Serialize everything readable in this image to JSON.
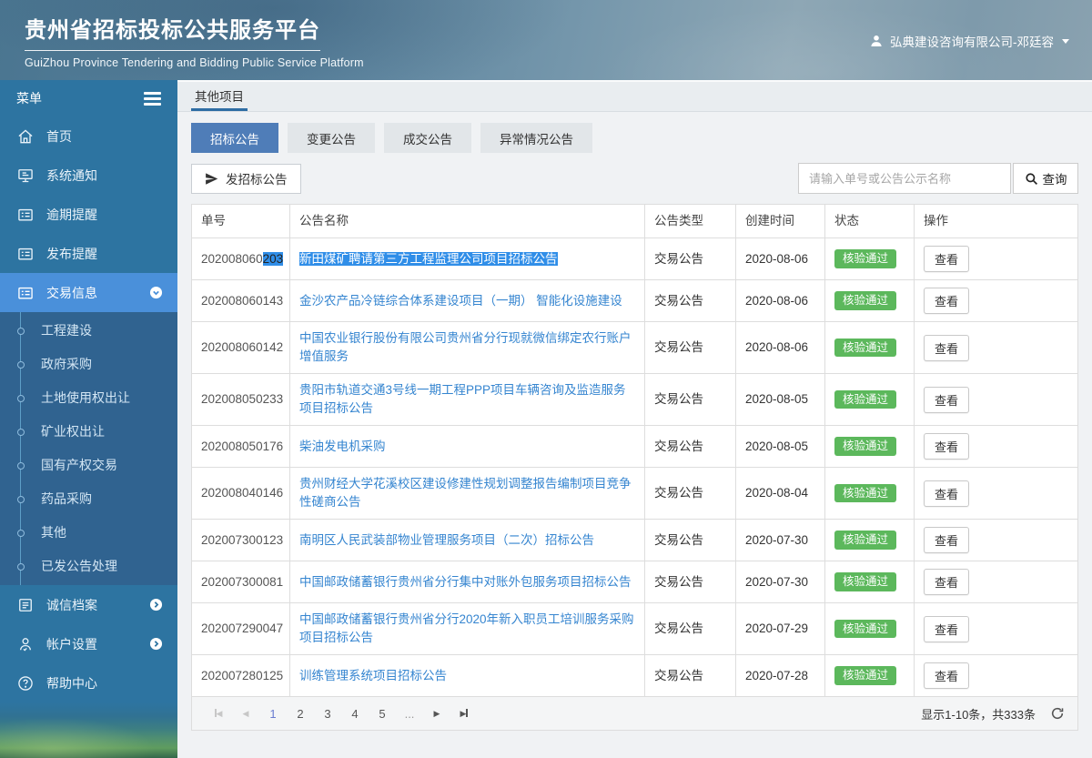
{
  "header": {
    "title": "贵州省招标投标公共服务平台",
    "subtitle": "GuiZhou Province Tendering and Bidding Public Service Platform",
    "user": "弘典建设咨询有限公司-邓廷容"
  },
  "sidebar": {
    "menu_label": "菜单",
    "items": [
      {
        "label": "首页",
        "icon": "home-icon"
      },
      {
        "label": "系统通知",
        "icon": "monitor-icon"
      },
      {
        "label": "逾期提醒",
        "icon": "folder-list-icon"
      },
      {
        "label": "发布提醒",
        "icon": "folder-list-icon"
      },
      {
        "label": "交易信息",
        "icon": "folder-list-icon",
        "active": true,
        "expanded": true
      }
    ],
    "submenu": [
      "工程建设",
      "政府采购",
      "土地使用权出让",
      "矿业权出让",
      "国有产权交易",
      "药品采购",
      "其他",
      "已发公告处理"
    ],
    "bottom_items": [
      {
        "label": "诚信档案",
        "icon": "list-icon",
        "chevron": "chevron-right-circle-icon"
      },
      {
        "label": "帐户设置",
        "icon": "user-outline-icon",
        "chevron": "chevron-right-circle-icon"
      },
      {
        "label": "帮助中心",
        "icon": "question-circle-icon"
      }
    ]
  },
  "main": {
    "page_tab": "其他项目",
    "tabs": [
      "招标公告",
      "变更公告",
      "成交公告",
      "异常情况公告"
    ],
    "active_tab": "招标公告",
    "publish_button": "发招标公告",
    "search": {
      "placeholder": "请输入单号或公告公示名称",
      "button": "查询"
    },
    "table": {
      "headers": [
        "单号",
        "公告名称",
        "公告类型",
        "创建时间",
        "状态",
        "操作"
      ],
      "status_label": "核验通过",
      "view_label": "查看",
      "rows": [
        {
          "no": "202008060",
          "no_selected": "203",
          "title": "新田煤矿聘请第三方工程监理公司项目招标公告",
          "selected": true,
          "type": "交易公告",
          "date": "2020-08-06"
        },
        {
          "no": "202008060143",
          "title": "金沙农产品冷链综合体系建设项目（一期） 智能化设施建设",
          "type": "交易公告",
          "date": "2020-08-06"
        },
        {
          "no": "202008060142",
          "title": "中国农业银行股份有限公司贵州省分行现就微信绑定农行账户增值服务",
          "type": "交易公告",
          "date": "2020-08-06"
        },
        {
          "no": "202008050233",
          "title": "贵阳市轨道交通3号线一期工程PPP项目车辆咨询及监造服务项目招标公告",
          "type": "交易公告",
          "date": "2020-08-05"
        },
        {
          "no": "202008050176",
          "title": "柴油发电机采购",
          "type": "交易公告",
          "date": "2020-08-05"
        },
        {
          "no": "202008040146",
          "title": "贵州财经大学花溪校区建设修建性规划调整报告编制项目竞争性磋商公告",
          "type": "交易公告",
          "date": "2020-08-04"
        },
        {
          "no": "202007300123",
          "title": "南明区人民武装部物业管理服务项目（二次）招标公告",
          "type": "交易公告",
          "date": "2020-07-30"
        },
        {
          "no": "202007300081",
          "title": "中国邮政储蓄银行贵州省分行集中对账外包服务项目招标公告",
          "type": "交易公告",
          "date": "2020-07-30"
        },
        {
          "no": "202007290047",
          "title": "中国邮政储蓄银行贵州省分行2020年新入职员工培训服务采购项目招标公告",
          "type": "交易公告",
          "date": "2020-07-29"
        },
        {
          "no": "202007280125",
          "title": "训练管理系统项目招标公告",
          "type": "交易公告",
          "date": "2020-07-28"
        }
      ]
    },
    "pagination": {
      "pages": [
        "1",
        "2",
        "3",
        "4",
        "5"
      ],
      "current": "1",
      "ellipsis": "...",
      "summary": "显示1-10条，共333条"
    }
  },
  "colors": {
    "sidebar": "#2d74a1",
    "sidebar_active": "#4a90da",
    "submenu": "#306390",
    "tab_active": "#4f7db8",
    "page_tab_underline": "#2e6da4",
    "badge_green": "#5cb85c",
    "link": "#3585d0",
    "selection": "#308ee8"
  }
}
